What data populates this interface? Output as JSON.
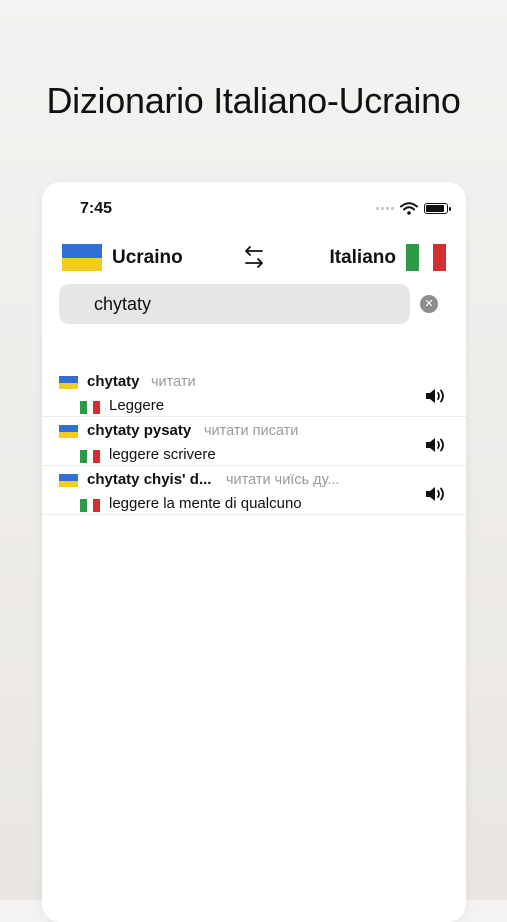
{
  "headline": "Dizionario Italiano-Ucraino",
  "status": {
    "time": "7:45"
  },
  "languages": {
    "source": "Ucraino",
    "target": "Italiano"
  },
  "colors": {
    "ua_blue": "#2f6fd6",
    "ua_yellow": "#f4cc1d",
    "it_green": "#2e9a48",
    "it_white": "#ffffff",
    "it_red": "#d32f2f"
  },
  "search": {
    "value": "chytaty",
    "clear_icon": "clear-circle-icon"
  },
  "results": [
    {
      "word": "chytaty",
      "cyrillic": "читати",
      "translation": "Leggere"
    },
    {
      "word": "chytaty pysaty",
      "cyrillic": "читати писати",
      "translation": "leggere scrivere"
    },
    {
      "word": "chytaty chyis' d...",
      "cyrillic": "читати чиїсь ду...",
      "translation": "leggere la mente di qualcuno"
    }
  ]
}
